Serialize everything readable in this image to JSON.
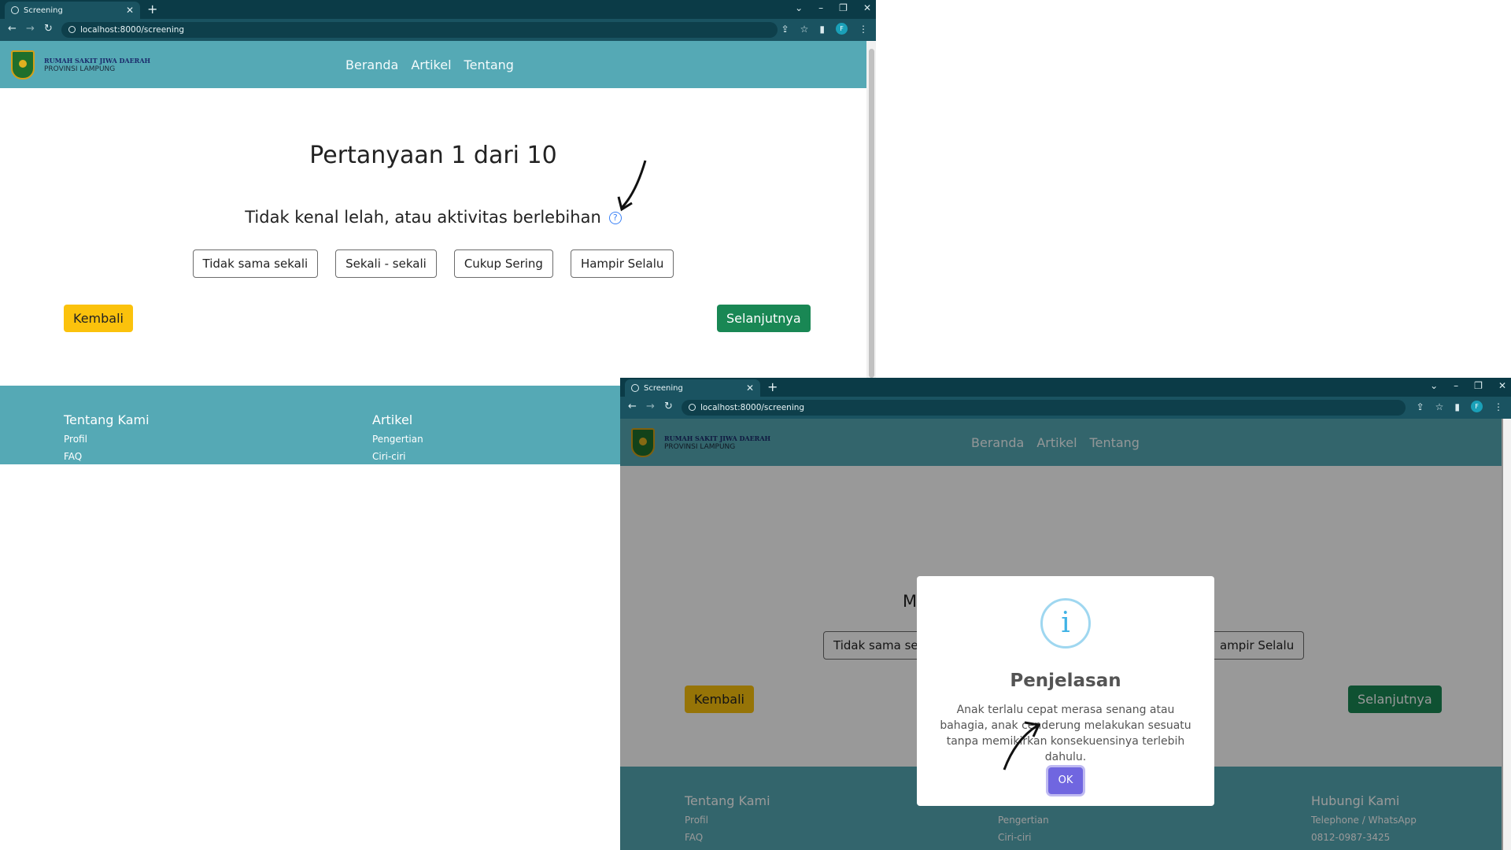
{
  "browser": {
    "tab_title": "Screening",
    "url": "localhost:8000/screening",
    "profile_initial": "F"
  },
  "site": {
    "logo_line1": "RUMAH SAKIT JIWA DAERAH",
    "logo_line2": "PROVINSI LAMPUNG",
    "nav": [
      "Beranda",
      "Artikel",
      "Tentang"
    ]
  },
  "question": {
    "title": "Pertanyaan 1 dari 10",
    "text": "Tidak kenal lelah, atau aktivitas berlebihan",
    "text_partial_behind_modal": "M",
    "help_icon": "?",
    "options": [
      "Tidak sama sekali",
      "Sekali - sekali",
      "Cukup Sering",
      "Hampir Selalu"
    ],
    "options_partial_behind_modal": [
      "Tidak sama se",
      "ampir Selalu"
    ],
    "back_label": "Kembali",
    "next_label": "Selanjutnya"
  },
  "footer": {
    "columns": [
      {
        "heading": "Tentang Kami",
        "links": [
          "Profil",
          "FAQ"
        ]
      },
      {
        "heading": "Artikel",
        "links": [
          "Pengertian",
          "Ciri-ciri"
        ]
      },
      {
        "heading": "Hubungi Kami",
        "links": [
          "Telephone / WhatsApp",
          "0812-0987-3425"
        ]
      }
    ]
  },
  "modal": {
    "icon": "i",
    "title": "Penjelasan",
    "text": "Anak terlalu cepat merasa senang atau bahagia, anak cenderung melakukan sesuatu tanpa memikirkan konsekuensinya terlebih dahulu.",
    "ok_label": "OK"
  },
  "colors": {
    "navbar": "#55a9b5",
    "back_button": "#fbc20c",
    "next_button": "#198754",
    "ok_button": "#7066e0",
    "tab_bar": "#0b3b47"
  }
}
